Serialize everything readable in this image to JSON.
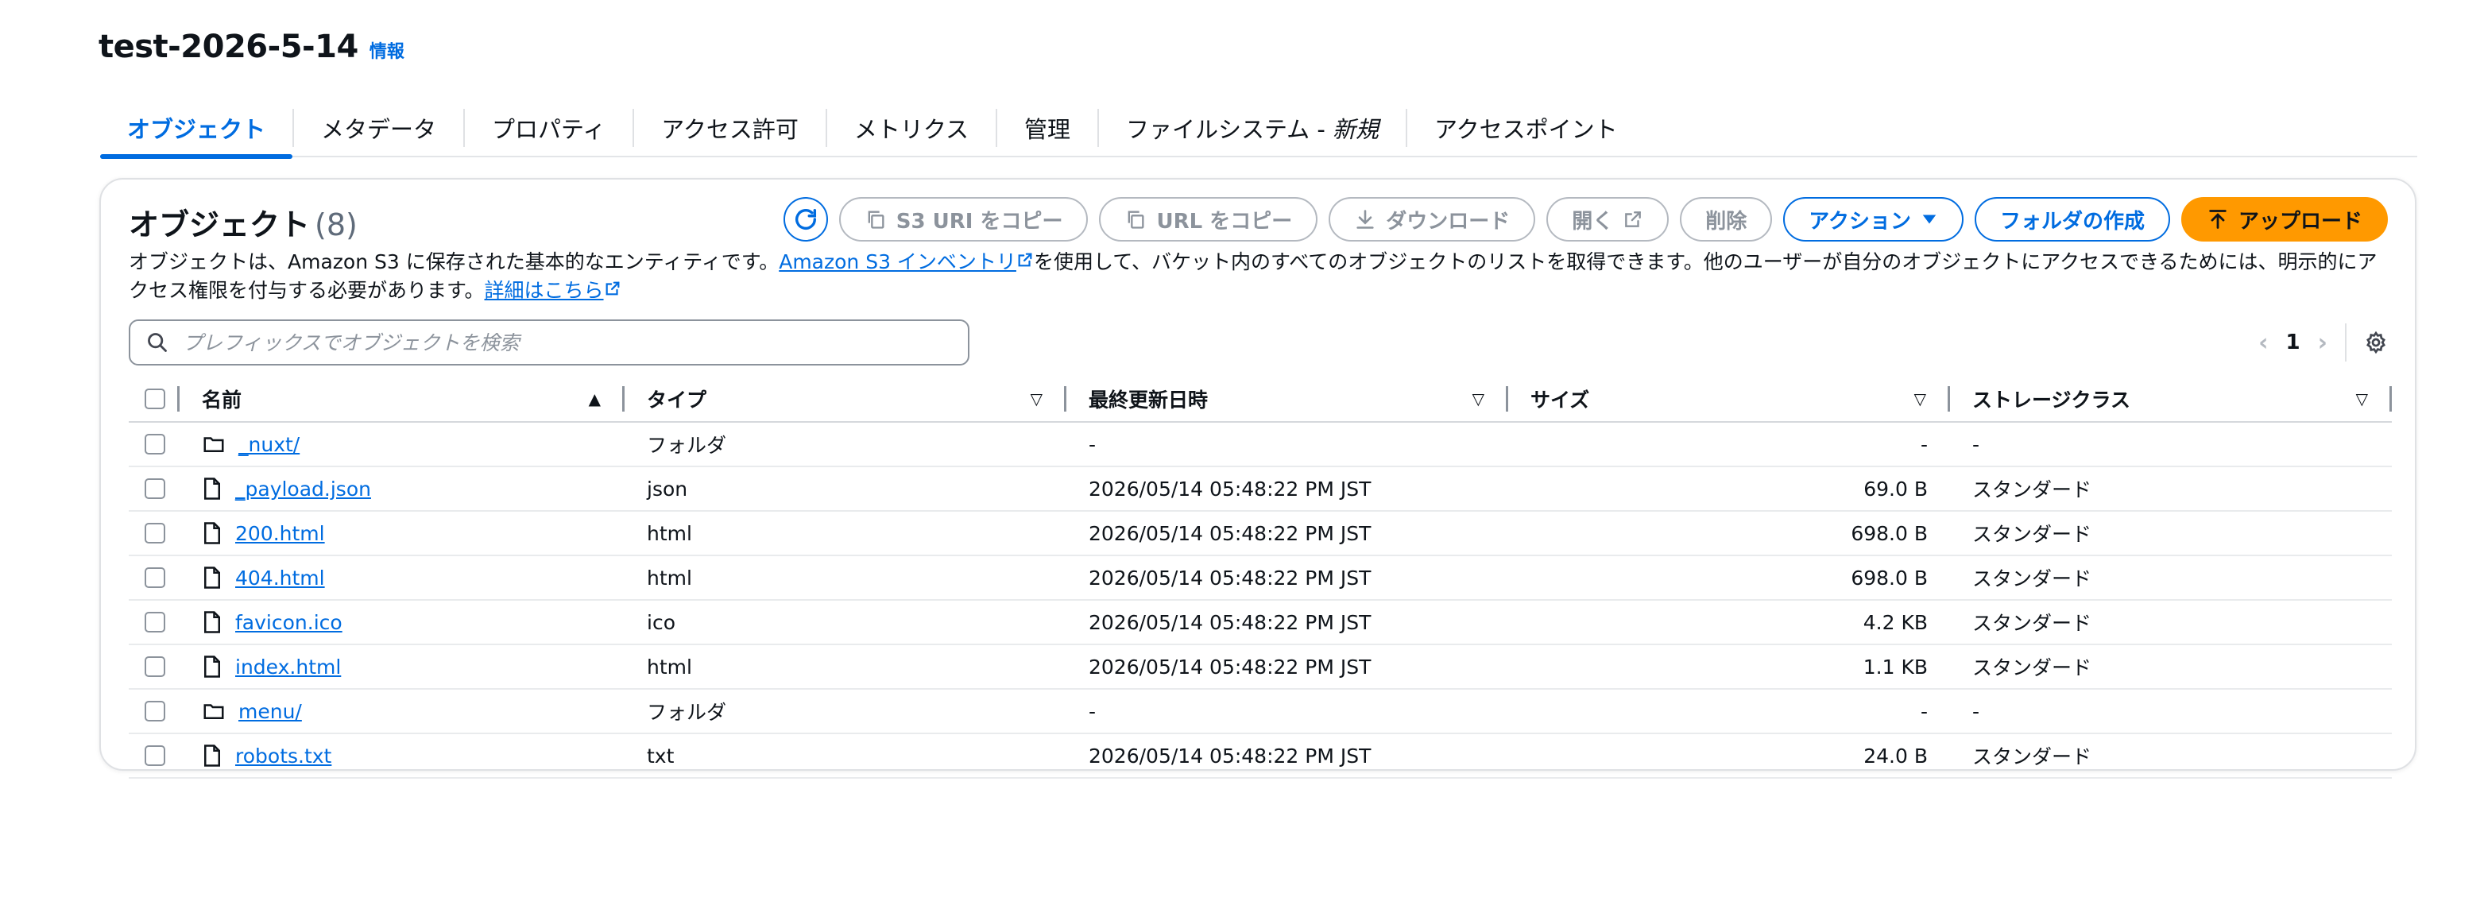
{
  "header": {
    "title": "test-2026-5-14",
    "info": "情報"
  },
  "tabs": [
    "オブジェクト",
    "メタデータ",
    "プロパティ",
    "アクセス許可",
    "メトリクス",
    "管理",
    "ファイルシステム - ",
    "アクセスポイント"
  ],
  "tab_new_label": "新規",
  "panel": {
    "title": "オブジェクト",
    "count": "(8)",
    "toolbar": {
      "copy_s3_uri": "S3 URI をコピー",
      "copy_url": "URL をコピー",
      "download": "ダウンロード",
      "open": "開く",
      "delete": "削除",
      "actions": "アクション",
      "create_folder": "フォルダの作成",
      "upload": "アップロード"
    },
    "description": {
      "part1": "オブジェクトは、Amazon S3 に保存された基本的なエンティティです。",
      "inventory_link": "Amazon S3 インベントリ",
      "part2": "を使用して、バケット内のすべてのオブジェクトのリストを取得できます。他のユーザーが自分のオブジェクトにアクセスできるためには、明示的にアクセス権限を付与する必要があります。",
      "learn_more": "詳細はこちら"
    },
    "search_placeholder": "プレフィックスでオブジェクトを検索",
    "page": "1"
  },
  "columns": {
    "name": "名前",
    "type": "タイプ",
    "modified": "最終更新日時",
    "size": "サイズ",
    "storage_class": "ストレージクラス"
  },
  "rows": [
    {
      "name": "_nuxt/",
      "icon": "folder-icon",
      "type": "フォルダ",
      "modified": "-",
      "size": "-",
      "class": "-"
    },
    {
      "name": "_payload.json",
      "icon": "file-icon",
      "type": "json",
      "modified": "2026/05/14 05:48:22 PM JST",
      "size": "69.0 B",
      "class": "スタンダード"
    },
    {
      "name": "200.html",
      "icon": "file-icon",
      "type": "html",
      "modified": "2026/05/14 05:48:22 PM JST",
      "size": "698.0 B",
      "class": "スタンダード"
    },
    {
      "name": "404.html",
      "icon": "file-icon",
      "type": "html",
      "modified": "2026/05/14 05:48:22 PM JST",
      "size": "698.0 B",
      "class": "スタンダード"
    },
    {
      "name": "favicon.ico",
      "icon": "file-icon",
      "type": "ico",
      "modified": "2026/05/14 05:48:22 PM JST",
      "size": "4.2 KB",
      "class": "スタンダード"
    },
    {
      "name": "index.html",
      "icon": "file-icon",
      "type": "html",
      "modified": "2026/05/14 05:48:22 PM JST",
      "size": "1.1 KB",
      "class": "スタンダード"
    },
    {
      "name": "menu/",
      "icon": "folder-icon",
      "type": "フォルダ",
      "modified": "-",
      "size": "-",
      "class": "-"
    },
    {
      "name": "robots.txt",
      "icon": "file-icon",
      "type": "txt",
      "modified": "2026/05/14 05:48:22 PM JST",
      "size": "24.0 B",
      "class": "スタンダード"
    }
  ],
  "colors": {
    "accent": "#006ce0",
    "upload": "#ff9900",
    "text": "#0f141a",
    "muted": "#8c939c"
  }
}
